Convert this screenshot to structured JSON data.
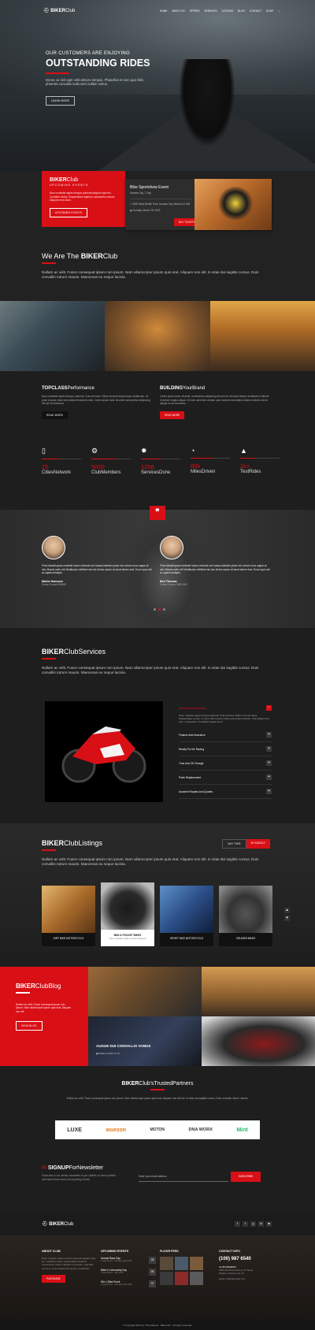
{
  "nav": {
    "logo_bold": "BIKER",
    "logo_light": "Club",
    "links": [
      "HOME",
      "ABOUT US",
      "OFFERS",
      "SERVICES",
      "LISTINGS",
      "BLOG",
      "CONTACT",
      "SHOP"
    ]
  },
  "hero": {
    "subtitle": "OUR CUSTOMERS ARE ENJOYING",
    "title": "OUTSTANDING RIDES",
    "text": "Donec ac nisl eget velit ultrices tempus. Phasellus et sem quis felis pharetra convallis nulla sem nullam varius.",
    "button": "LEARN MORE"
  },
  "events": {
    "brand_bold": "BIKER",
    "brand_light": "Club",
    "heading": "UPCOMING EVENTS",
    "text": "Nunc molestie sapien tempor placerat aliquam eget leo. Curabitur lectus. Suspendisse dapibus consectetur mauris. Aliquam urna dolor.",
    "button": "UPCOMING EVENTS",
    "card_title": "Bike Sportshow Event",
    "card_location": "Kansas City, 7 Day",
    "card_address": "1835 Sauk Berdin Fork, Kansas City, Missouri 2.006",
    "card_date": "Sunday, March 28, 2015",
    "card_button": "BUY TICKETS"
  },
  "about": {
    "title_pre": "We Are The ",
    "title_bold": "BIKER",
    "title_light": "Club",
    "text": "Nullam ac velit. Fusce consequat ipsum non ipsum. Nam ullamcorper ipsum quis erat. Aliquam non elit. In vitae dui sagittis cursus. Duis convallis rutrum mauris. Maecenas eu neque lacinia."
  },
  "features": [
    {
      "bold": "TOPCLASS",
      "light": "Performance",
      "text": "Nunc molestie sapien tempor placerat. Cras at lectus. Etiam sit amet turpis turpis vestibulum. Ut proin a ipsum vitae erat pretium tincidunt nulla. Lorem ipsum dolor sit amet consectetur adipiscing elit sed do eiusmod.",
      "button": "READ MORE"
    },
    {
      "bold": "BUILDING",
      "light": "YourBrand",
      "text": "Lorem ipsum dolor sit amet, consectetur adipiscing elit sed do eiusmod tempor incididunt ut labore et dolore magna aliqua. Ut enim ad minim veniam quis nostrud exercitation ullamco laboris nisi ut aliquip ex ea commodo.",
      "button": "READ MORE"
    }
  ],
  "stats": [
    {
      "icon": "building-icon",
      "glyph": "▯",
      "value": "25",
      "label": "CitiesNetwork",
      "progress": 0.45
    },
    {
      "icon": "motorcycle-icon",
      "glyph": "⚙",
      "value": "5000",
      "label": "ClubMembers",
      "progress": 0.6
    },
    {
      "icon": "gear-icon",
      "glyph": "✹",
      "value": "1258",
      "label": "ServicesDone",
      "progress": 0.5
    },
    {
      "icon": "speedometer-icon",
      "glyph": "◔",
      "value": "60k",
      "label": "MilesDriven",
      "progress": 0.55
    },
    {
      "icon": "road-icon",
      "glyph": "▲",
      "value": "1k+",
      "label": "TestRides",
      "progress": 0.4
    }
  ],
  "testimonials": {
    "quote_glyph": "❞",
    "items": [
      {
        "text": "Proin blandit quam molestie luctus vehicula orci massa interdum justo nec rutrum risus augue at nisl. Mauris nulla, elit Vestibulum eleifend nisl nec lectus auctor sit amet donec erat. Fusce quis nisl ac sapien tristique.",
        "name": "Martin Hammen",
        "role": "Owner Ducati 999999"
      },
      {
        "text": "Proin blandit quam molestie luctus vehicula orci massa interdum justo nec rutrum risus augue at nisl. Mauris nulla, elit Vestibulum eleifend nisl nec lectus auctor sit amet donec erat. Fusce quis nisl ac sapien tristique.",
        "name": "Ben Thomas",
        "role": "Owner Honda CBR1000"
      }
    ]
  },
  "services": {
    "title_bold": "BIKER",
    "title_light": "ClubServices",
    "text": "Nullam ac velit. Fusce consequat ipsum non ipsum. Nam ullamcorper ipsum quis erat. Aliquam non elit. In vitae dui sagittis cursus. Duis convallis rutrum mauris. Maecenas eu neque lacinia.",
    "accordion_open": {
      "title": "Motorcycle Inspections",
      "text": "Nunc molestie sapien tempor placerat. Cras et lectus. Etiam sit amet turpis. Suspendisse et sem. In proin nibh a ipsum vitae erat pretium lobortis. Cras aliquet sed ante, consectetur ut sodales feugiat lorem."
    },
    "accordion_items": [
      "Finance And Insurance",
      "Ready For the Racing",
      "Tune And Oil Change",
      "Parts Replacement",
      "Accident Repairs And Quotes"
    ]
  },
  "listings": {
    "title_bold": "BIKER",
    "title_light": "ClubListings",
    "tab_all": "BUY THIS",
    "tab_active": "BY AGENCY",
    "text": "Nullam ac velit. Fusce consequat ipsum non ipsum. Nam ullamcorper ipsum quis erat. Aliquam non elit. In vitae dui sagittis cursus. Duis convallis rutrum mauris. Maecenas eu neque lacinia.",
    "items": [
      "DIRT BIKE MOTORCYCLE",
      "MINI & POCKET BIKES",
      "SPORT BIKE MOTORCYCLE",
      "CRUISER BIKES"
    ],
    "featured_sub": "Nunc molestie sapien tempor placerat"
  },
  "blog": {
    "title_bold": "BIKER",
    "title_light": "ClubBlog",
    "text": "Nullam ac velit. Fusce consequat ipsum non ipsum. Nam ullamcorper ipsum quis erat. Aliquam non elit.",
    "button": "VIEW BLOG",
    "post_title": "AUGUE DUI CONVALLIS VAMUS",
    "post_date": "MARCH 2015",
    "post_comments": "10"
  },
  "partners": {
    "title_bold": "BIKER",
    "title_light": "Club'sTrustedPartners",
    "text": "Nullam ac velit. Fusce consequat ipsum non ipsum. Nam ullamcorper ipsum quis erat. Aliquam non elit dui. In vitae dui sagittis cursus. Duis convallis rutrum mauris.",
    "logos": [
      "LUXE",
      "wuezon",
      "MOTON",
      "DNA WORX",
      "Mint"
    ]
  },
  "newsletter": {
    "title_bold": "SIGNUP",
    "title_light": "ForNewsletter",
    "text": "Subscribe to our weekly newsletter to get notified on rides updated with latest News news and sporting events!",
    "placeholder": "Enter your email address",
    "button": "SUBSCRIBE"
  },
  "footer": {
    "logo_bold": "BIKER",
    "logo_light": "Club",
    "social": [
      "t",
      "f",
      "g",
      "in",
      "◙"
    ],
    "about_title": "ABOUT CLUB",
    "about_text": "Nunc molestie sapien tempor placerat aliquam eget leo. Curabitur lectus. Suspendisse dapibus consectetur mauris. Aliquam urna dolor, vulputate nec sem. Cras tristique fermentum vestibulum.",
    "about_button": "PURCHASE",
    "events_title": "UPCOMING EVENTS",
    "events": [
      {
        "name": "Annual Race Day",
        "meta": "1 days Event · Sunday, Iowa 2015",
        "day": "28"
      },
      {
        "name": "Biker's Community Day",
        "meta": "1 days Event · Sun 2015",
        "day": "26"
      },
      {
        "name": "Win 1-Bike Event",
        "meta": "1 days Event · Sun April 20th 2015",
        "day": "37"
      }
    ],
    "flickr_title": "FLICKR FEED",
    "contact_title": "CONTACT INFO",
    "phone": "(100) 987 6540",
    "contact_lines": [
      "CLUB ADDRESS",
      "1835 Oak Brook Avenue, 67 Street",
      "Rayburn, Kansas City 3.6",
      "Email: info@bikerclub.com"
    ],
    "copyright": "© Copyright 2015 by ThemeRevel - BikerClub . All rights reserved."
  }
}
